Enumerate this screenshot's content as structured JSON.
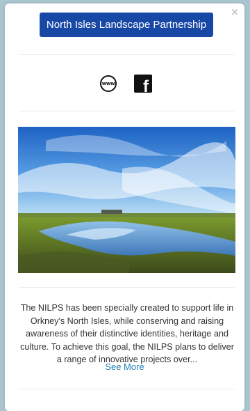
{
  "popup": {
    "title": "North Isles Landscape Partnership",
    "close_glyph": "×",
    "description": "The NILPS has been specially created to support life in Orkney's North Isles, while conserving and raising awareness of their distinctive identities, heritage and culture. To achieve this goal, the NILPS plans to deliver a range of innovative projects over...",
    "see_more": "See More"
  },
  "links": [
    {
      "icon": "www-icon",
      "label": "www"
    },
    {
      "icon": "facebook-icon",
      "label": "f"
    }
  ],
  "colors": {
    "title_button": "#1848a6",
    "link": "#1f7fb8",
    "background": "#a9c6cf"
  }
}
